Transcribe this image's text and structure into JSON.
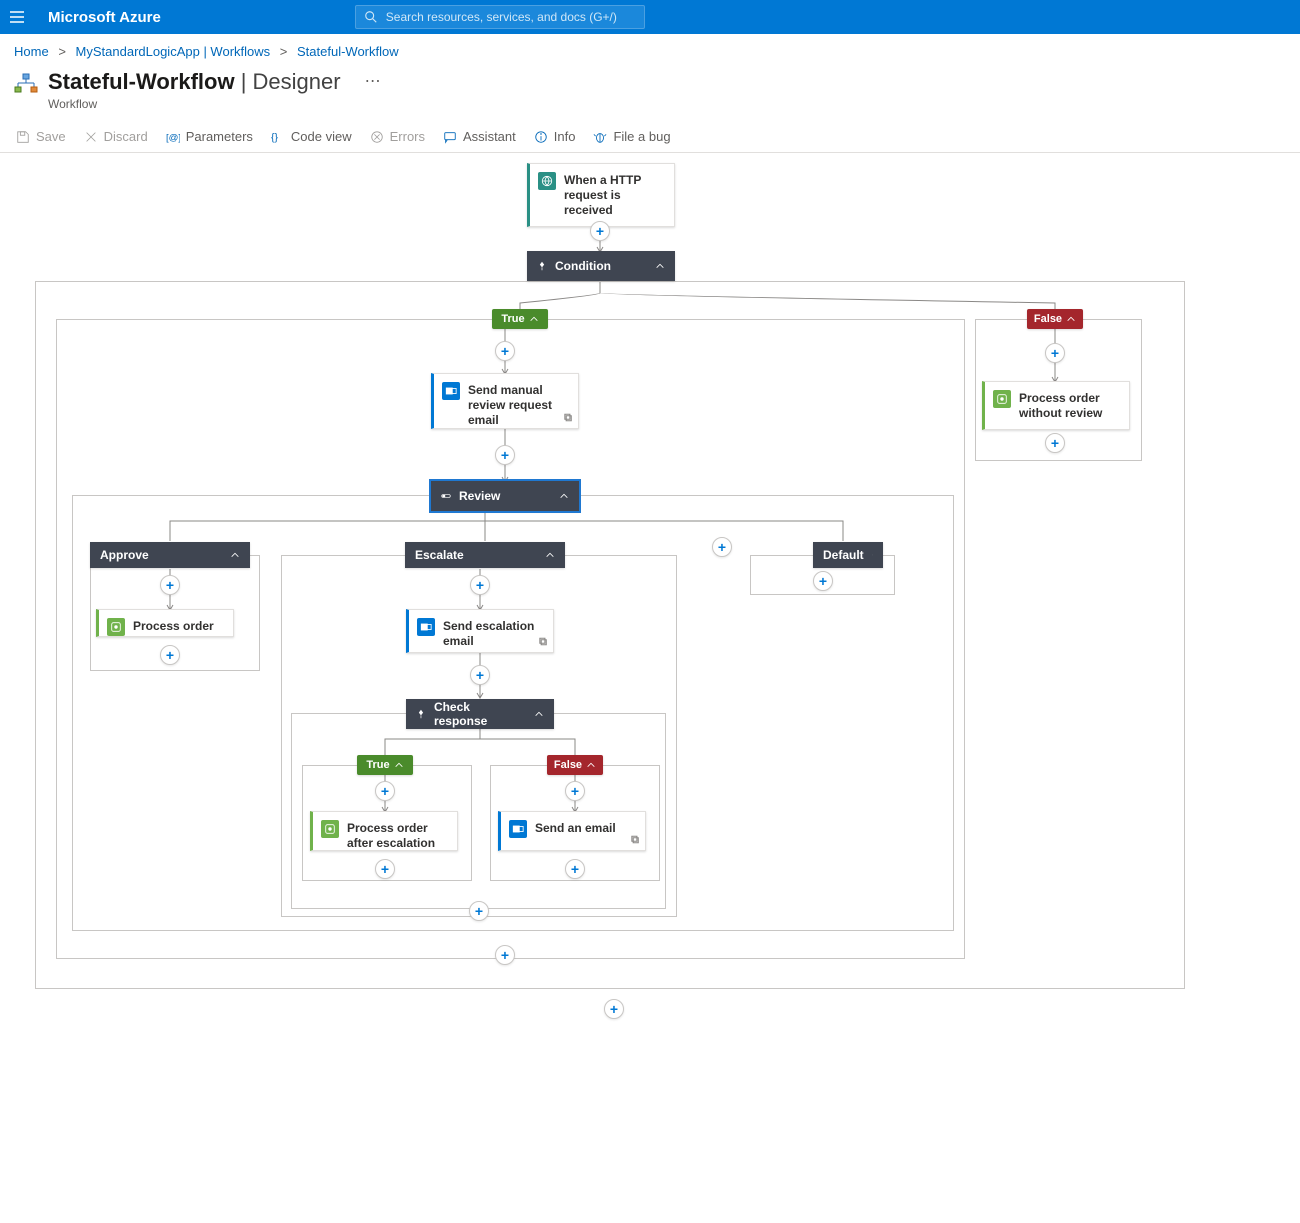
{
  "header": {
    "brand": "Microsoft Azure",
    "search_placeholder": "Search resources, services, and docs (G+/)"
  },
  "breadcrumbs": {
    "home": "Home",
    "app": "MyStandardLogicApp | Workflows",
    "wf": "Stateful-Workflow"
  },
  "page": {
    "title": "Stateful-Workflow",
    "title_suffix": " | Designer",
    "subtitle": "Workflow"
  },
  "toolbar": {
    "save": "Save",
    "discard": "Discard",
    "parameters": "Parameters",
    "codeview": "Code view",
    "errors": "Errors",
    "assistant": "Assistant",
    "info": "Info",
    "fileabug": "File a bug"
  },
  "designer": {
    "trigger": "When a HTTP request is received",
    "condition": "Condition",
    "true": "True",
    "false": "False",
    "send_manual_review": "Send manual review request email",
    "review_switch": "Review",
    "case_approve": "Approve",
    "case_escalate": "Escalate",
    "case_default": "Default",
    "process_order": "Process order",
    "send_escalation": "Send escalation email",
    "check_response": "Check response",
    "process_after_escalation": "Process order after escalation",
    "send_an_email": "Send an email",
    "process_without_review": "Process order without review"
  }
}
